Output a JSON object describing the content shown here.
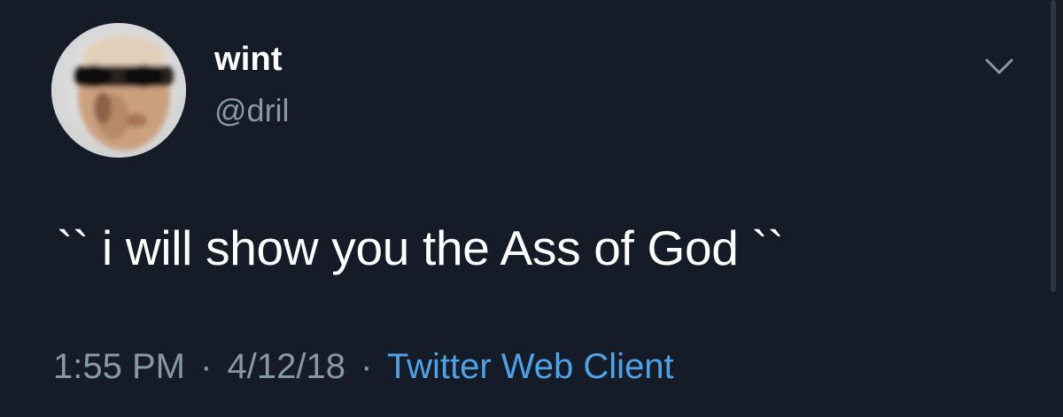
{
  "author": {
    "display_name": "wint",
    "handle": "@dril"
  },
  "tweet": {
    "text": "`` i will show you the Ass of God ``"
  },
  "meta": {
    "time": "1:55 PM",
    "separator": "·",
    "date": "4/12/18",
    "client": "Twitter Web Client"
  },
  "icons": {
    "menu": "chevron-down-icon",
    "avatar": "avatar"
  },
  "colors": {
    "background": "#151c28",
    "primary_text": "#ffffff",
    "secondary_text": "#8899a6",
    "link": "#4ea3e8"
  }
}
